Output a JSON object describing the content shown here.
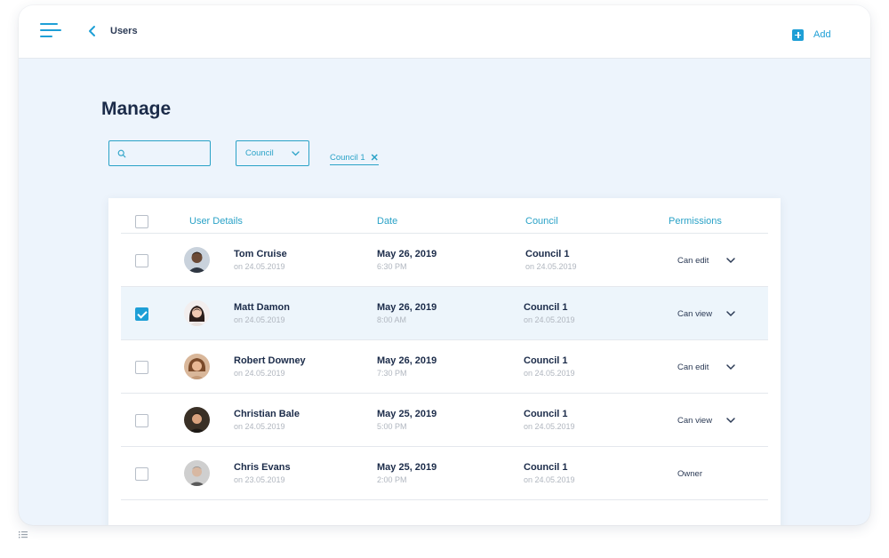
{
  "header": {
    "breadcrumb": "Users",
    "add_label": "Add"
  },
  "page": {
    "title": "Manage"
  },
  "filters": {
    "search_value": "",
    "council_select": "Council",
    "active_chip": "Council 1"
  },
  "table": {
    "columns": [
      "User Details",
      "Date",
      "Council",
      "Permissions"
    ],
    "rows": [
      {
        "name": "Tom Cruise",
        "joined": "on 24.05.2019",
        "date": "May 26, 2019",
        "time": "6:30 PM",
        "council": "Council 1",
        "council_date": "on 24.05.2019",
        "permission": "Can edit",
        "has_dropdown": true,
        "checked": false,
        "avatar_color": "#5a4a3f"
      },
      {
        "name": "Matt Damon",
        "joined": "on 24.05.2019",
        "date": "May 26, 2019",
        "time": "8:00 AM",
        "council": "Council 1",
        "council_date": "on 24.05.2019",
        "permission": "Can view",
        "has_dropdown": true,
        "checked": true,
        "avatar_color": "#3a2b28"
      },
      {
        "name": "Robert Downey",
        "joined": "on 24.05.2019",
        "date": "May 26, 2019",
        "time": "7:30 PM",
        "council": "Council 1",
        "council_date": "on 24.05.2019",
        "permission": "Can edit",
        "has_dropdown": true,
        "checked": false,
        "avatar_color": "#8a5a3a"
      },
      {
        "name": "Christian Bale",
        "joined": "on 24.05.2019",
        "date": "May 25, 2019",
        "time": "5:00 PM",
        "council": "Council 1",
        "council_date": "on 24.05.2019",
        "permission": "Can view",
        "has_dropdown": true,
        "checked": false,
        "avatar_color": "#4a3a2a"
      },
      {
        "name": "Chris Evans",
        "joined": "on 23.05.2019",
        "date": "May 25, 2019",
        "time": "2:00 PM",
        "council": "Council 1",
        "council_date": "on 24.05.2019",
        "permission": "Owner",
        "has_dropdown": false,
        "checked": false,
        "avatar_color": "#9a9a9a"
      }
    ]
  },
  "colors": {
    "accent": "#1e9fd6",
    "background": "#edf4fc",
    "heading": "#1b2b49"
  }
}
